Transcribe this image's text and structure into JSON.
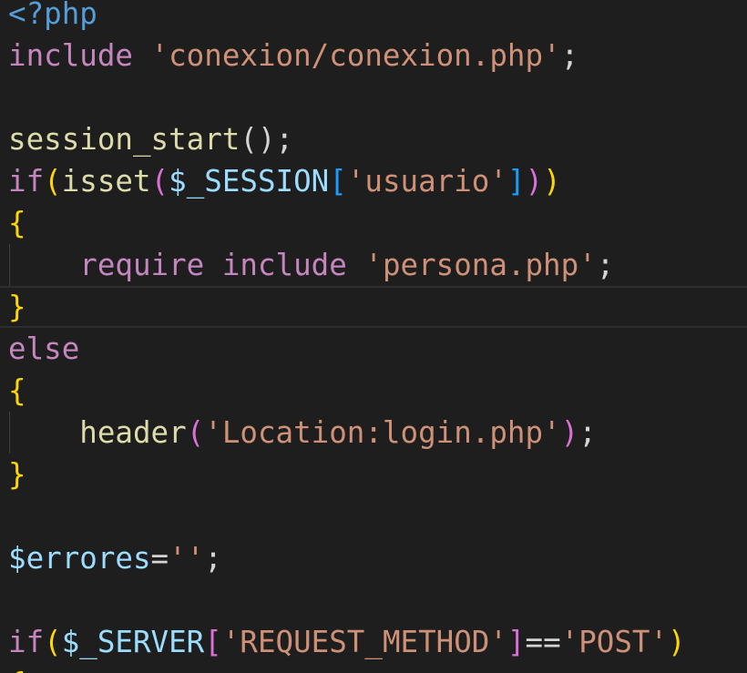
{
  "editor": {
    "lines": [
      [
        {
          "t": "<?php",
          "c": "tag"
        }
      ],
      [
        {
          "t": "include",
          "c": "kw"
        },
        {
          "t": " ",
          "c": "plain"
        },
        {
          "t": "'conexion/conexion.php'",
          "c": "str"
        },
        {
          "t": ";",
          "c": "plain"
        }
      ],
      [],
      [
        {
          "t": "session_start",
          "c": "fn"
        },
        {
          "t": "();",
          "c": "plain"
        }
      ],
      [
        {
          "t": "if",
          "c": "kw"
        },
        {
          "t": "(",
          "c": "brace1"
        },
        {
          "t": "isset",
          "c": "fn"
        },
        {
          "t": "(",
          "c": "brace2"
        },
        {
          "t": "$_SESSION",
          "c": "var"
        },
        {
          "t": "[",
          "c": "brace3"
        },
        {
          "t": "'usuario'",
          "c": "str"
        },
        {
          "t": "]",
          "c": "brace3"
        },
        {
          "t": ")",
          "c": "brace2"
        },
        {
          "t": ")",
          "c": "brace1"
        }
      ],
      [
        {
          "t": "{",
          "c": "brace1"
        }
      ],
      [
        {
          "t": "    ",
          "c": "plain"
        },
        {
          "t": "require",
          "c": "kw"
        },
        {
          "t": " ",
          "c": "plain"
        },
        {
          "t": "include",
          "c": "kw"
        },
        {
          "t": " ",
          "c": "plain"
        },
        {
          "t": "'persona.php'",
          "c": "str"
        },
        {
          "t": ";",
          "c": "plain"
        }
      ],
      [
        {
          "t": "}",
          "c": "brace1"
        }
      ],
      [
        {
          "t": "else",
          "c": "kw"
        }
      ],
      [
        {
          "t": "{",
          "c": "brace1"
        }
      ],
      [
        {
          "t": "    ",
          "c": "plain"
        },
        {
          "t": "header",
          "c": "fn"
        },
        {
          "t": "(",
          "c": "brace2"
        },
        {
          "t": "'Location:login.php'",
          "c": "str"
        },
        {
          "t": ")",
          "c": "brace2"
        },
        {
          "t": ";",
          "c": "plain"
        }
      ],
      [
        {
          "t": "}",
          "c": "brace1"
        }
      ],
      [],
      [
        {
          "t": "$errores",
          "c": "var"
        },
        {
          "t": "=",
          "c": "plain"
        },
        {
          "t": "''",
          "c": "str"
        },
        {
          "t": ";",
          "c": "plain"
        }
      ],
      [],
      [
        {
          "t": "if",
          "c": "kw"
        },
        {
          "t": "(",
          "c": "brace1"
        },
        {
          "t": "$_SERVER",
          "c": "var"
        },
        {
          "t": "[",
          "c": "brace2"
        },
        {
          "t": "'REQUEST_METHOD'",
          "c": "str"
        },
        {
          "t": "]",
          "c": "brace2"
        },
        {
          "t": "==",
          "c": "plain"
        },
        {
          "t": "'POST'",
          "c": "str"
        },
        {
          "t": ")",
          "c": "brace1"
        }
      ],
      [
        {
          "t": "{",
          "c": "brace1"
        }
      ]
    ]
  }
}
